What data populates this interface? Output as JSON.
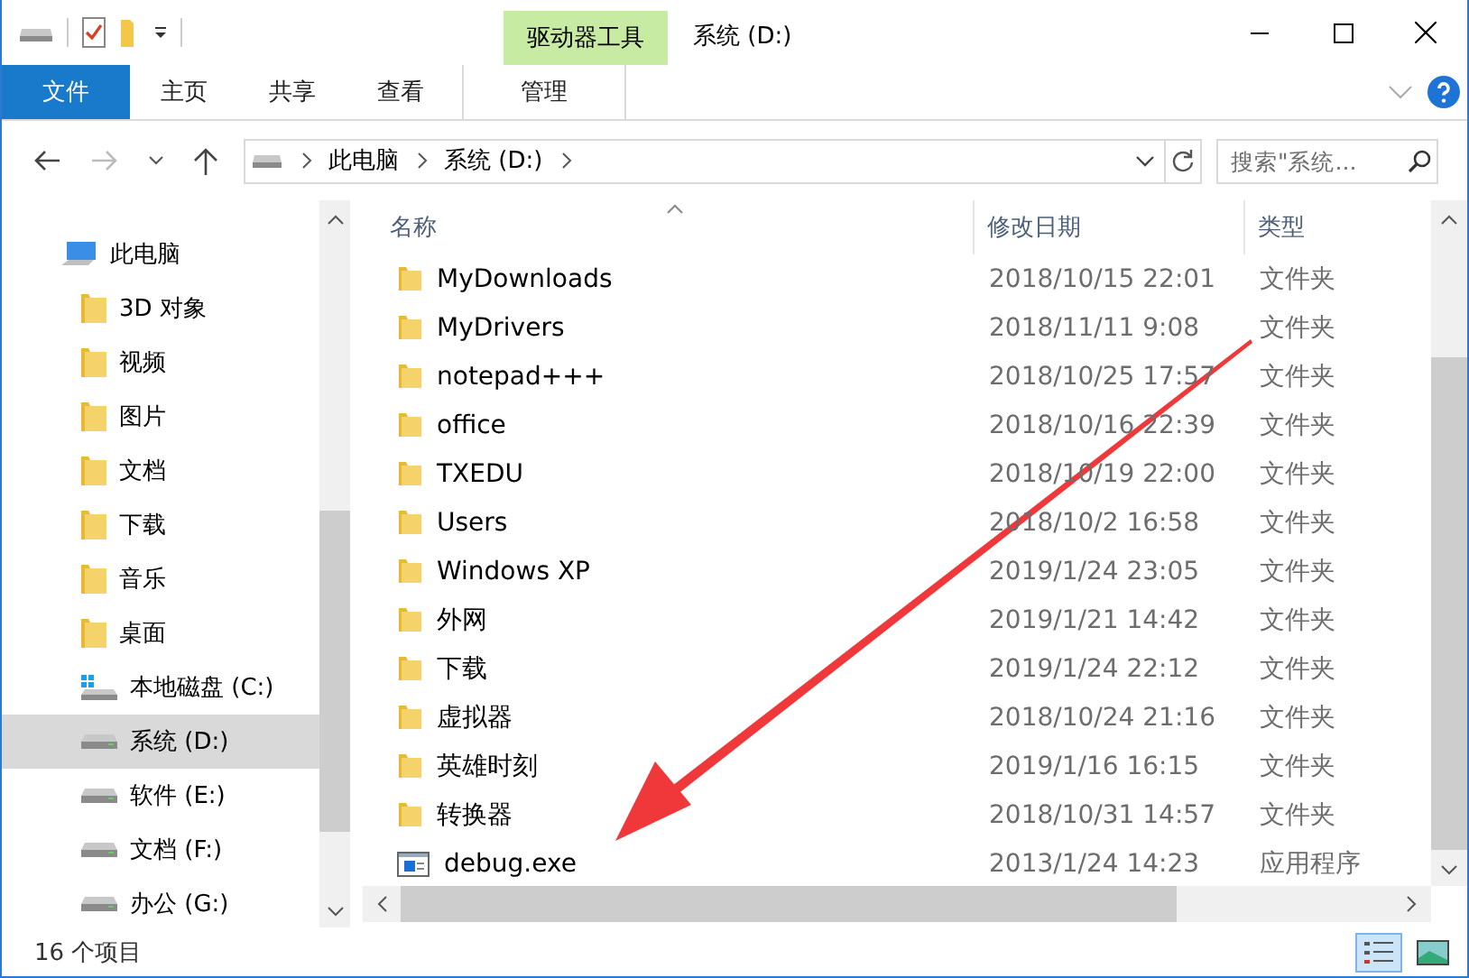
{
  "window": {
    "title": "系统 (D:)",
    "context_group": "驱动器工具"
  },
  "ribbon_tabs": [
    {
      "label": "文件",
      "kind": "file",
      "selected": false
    },
    {
      "label": "主页",
      "kind": "tab",
      "selected": false
    },
    {
      "label": "共享",
      "kind": "tab",
      "selected": false
    },
    {
      "label": "查看",
      "kind": "tab",
      "selected": false
    },
    {
      "label": "管理",
      "kind": "context",
      "selected": true
    }
  ],
  "address_bar": {
    "crumbs": [
      "此电脑",
      "系统 (D:)"
    ]
  },
  "search": {
    "placeholder": "搜索\"系统..."
  },
  "sidebar": {
    "items": [
      {
        "label": "此电脑",
        "kind": "pc",
        "selected": false,
        "children": [
          {
            "label": "3D 对象",
            "kind": "folder",
            "selected": false
          },
          {
            "label": "视频",
            "kind": "folder",
            "selected": false
          },
          {
            "label": "图片",
            "kind": "folder",
            "selected": false
          },
          {
            "label": "文档",
            "kind": "folder",
            "selected": false
          },
          {
            "label": "下载",
            "kind": "folder",
            "selected": false
          },
          {
            "label": "音乐",
            "kind": "folder",
            "selected": false
          },
          {
            "label": "桌面",
            "kind": "folder",
            "selected": false
          },
          {
            "label": "本地磁盘 (C:)",
            "kind": "windows-drive",
            "selected": false
          },
          {
            "label": "系统 (D:)",
            "kind": "drive",
            "selected": true
          },
          {
            "label": "软件 (E:)",
            "kind": "drive",
            "selected": false
          },
          {
            "label": "文档 (F:)",
            "kind": "drive",
            "selected": false
          },
          {
            "label": "办公 (G:)",
            "kind": "drive",
            "selected": false
          }
        ]
      }
    ]
  },
  "table": {
    "columns": [
      "名称",
      "修改日期",
      "类型"
    ],
    "rows": [
      {
        "name": "MyDownloads",
        "kind": "folder",
        "modified": "2018/10/15 22:01",
        "type": "文件夹"
      },
      {
        "name": "MyDrivers",
        "kind": "folder",
        "modified": "2018/11/11 9:08",
        "type": "文件夹"
      },
      {
        "name": "notepad+++",
        "kind": "folder",
        "modified": "2018/10/25 17:57",
        "type": "文件夹"
      },
      {
        "name": "office",
        "kind": "folder",
        "modified": "2018/10/16 22:39",
        "type": "文件夹"
      },
      {
        "name": "TXEDU",
        "kind": "folder",
        "modified": "2018/10/19 22:00",
        "type": "文件夹"
      },
      {
        "name": "Users",
        "kind": "folder",
        "modified": "2018/10/2 16:58",
        "type": "文件夹"
      },
      {
        "name": "Windows XP",
        "kind": "folder",
        "modified": "2019/1/24 23:05",
        "type": "文件夹"
      },
      {
        "name": "外网",
        "kind": "folder",
        "modified": "2019/1/21 14:42",
        "type": "文件夹"
      },
      {
        "name": "下载",
        "kind": "folder",
        "modified": "2019/1/24 22:12",
        "type": "文件夹"
      },
      {
        "name": "虚拟器",
        "kind": "folder",
        "modified": "2018/10/24 21:16",
        "type": "文件夹"
      },
      {
        "name": "英雄时刻",
        "kind": "folder",
        "modified": "2019/1/16 16:15",
        "type": "文件夹"
      },
      {
        "name": "转换器",
        "kind": "folder",
        "modified": "2018/10/31 14:57",
        "type": "文件夹"
      },
      {
        "name": "debug.exe",
        "kind": "exe",
        "modified": "2013/1/24 14:23",
        "type": "应用程序"
      }
    ]
  },
  "status_bar": {
    "item_count": "16 个项目"
  }
}
